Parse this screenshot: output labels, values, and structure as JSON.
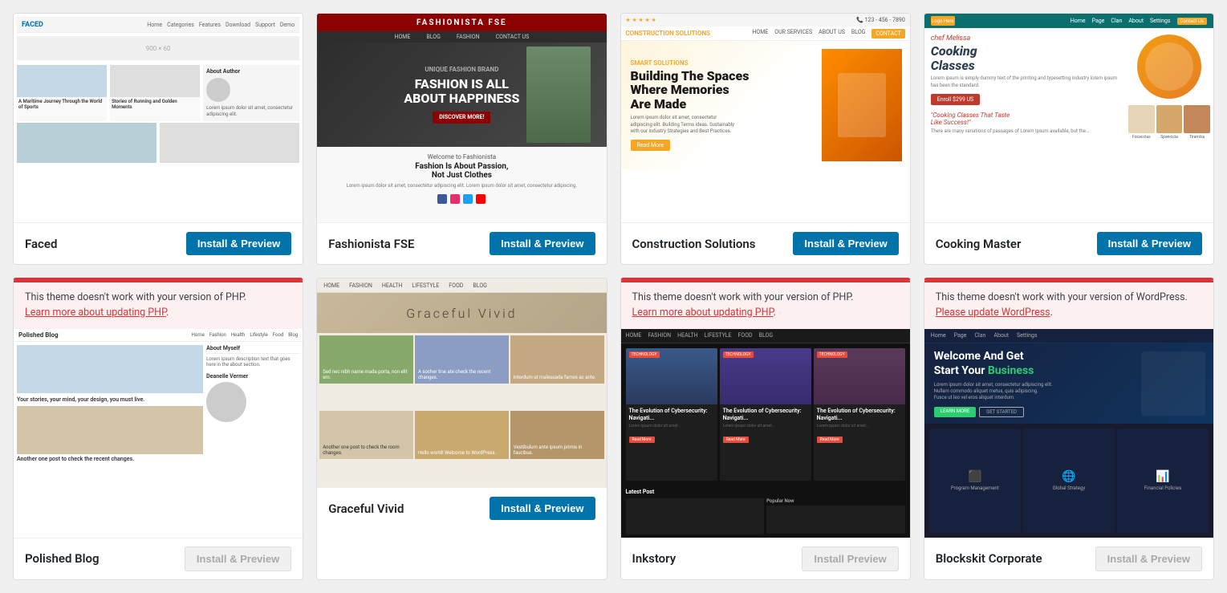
{
  "themes": [
    {
      "id": "faced",
      "name": "Faced",
      "installLabel": "Install & Preview",
      "hasError": false,
      "disabled": false,
      "previewClass": "preview-faced"
    },
    {
      "id": "fashionista",
      "name": "Fashionista FSE",
      "installLabel": "Install & Preview",
      "hasError": false,
      "disabled": false,
      "previewClass": "preview-fashionista"
    },
    {
      "id": "construction",
      "name": "Construction Solutions",
      "installLabel": "Install & Preview",
      "hasError": false,
      "disabled": false,
      "previewClass": "preview-construction"
    },
    {
      "id": "cooking",
      "name": "Cooking Master",
      "installLabel": "Install & Preview",
      "hasError": false,
      "disabled": false,
      "previewClass": "preview-cooking"
    },
    {
      "id": "polished",
      "name": "Polished Blog",
      "installLabel": "Install & Preview",
      "hasError": true,
      "errorText": "This theme doesn't work with your version of PHP.",
      "errorLinkText": "Learn more about updating PHP",
      "errorLinkHref": "#",
      "disabled": true,
      "previewClass": "preview-polished"
    },
    {
      "id": "graceful",
      "name": "Graceful Vivid",
      "installLabel": "Install & Preview",
      "hasError": false,
      "disabled": false,
      "previewClass": "preview-graceful"
    },
    {
      "id": "inkstory",
      "name": "Inkstory",
      "installLabel": "Install Preview",
      "hasError": true,
      "errorText": "This theme doesn't work with your version of PHP.",
      "errorLinkText": "Learn more about updating PHP",
      "errorLinkHref": "#",
      "disabled": true,
      "previewClass": "preview-inkstory"
    },
    {
      "id": "blockskit",
      "name": "Blockskit Corporate",
      "installLabel": "Install & Preview",
      "hasError": true,
      "errorText": "This theme doesn't work with your version of WordPress.",
      "errorLinkText": "Please update WordPress",
      "errorLinkHref": "#",
      "disabled": true,
      "previewClass": "preview-blockskit"
    }
  ]
}
